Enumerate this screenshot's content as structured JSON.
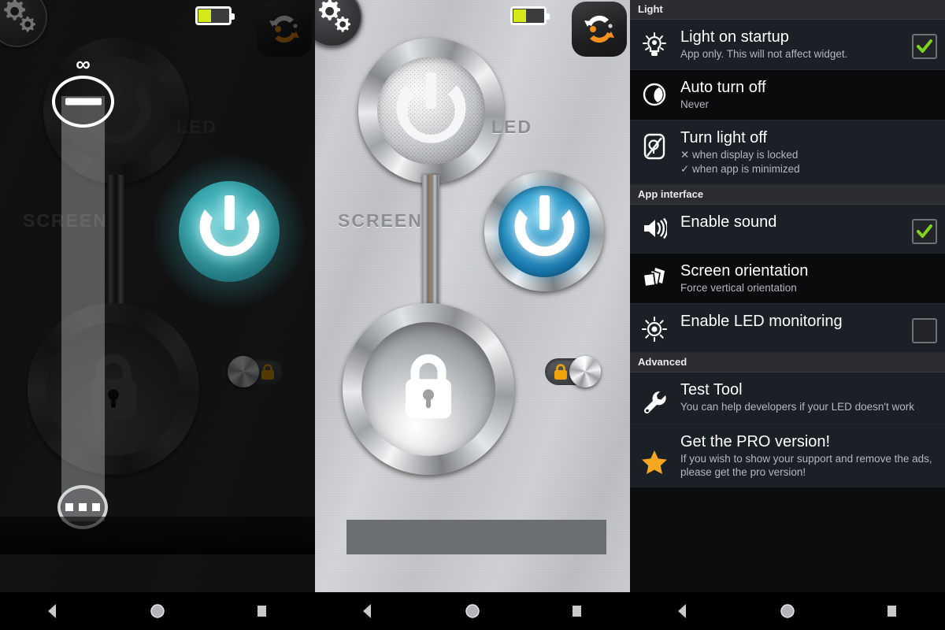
{
  "app": {
    "labels": {
      "screen": "SCREEN",
      "led": "LED",
      "infinity": "∞"
    },
    "battery": {
      "level_percent": 40
    },
    "icons": {
      "settings": "gears-icon",
      "battery": "battery-icon",
      "sync": "sync-rotate-icon",
      "screen_power": "power-icon",
      "led_power": "power-icon",
      "lock": "lock-icon",
      "slider_minus": "minus-icon",
      "slider_more": "more-dots-icon"
    },
    "lock_toggle": {
      "left_state": "off",
      "middle_state": "on"
    }
  },
  "navbar": {
    "back": "back-triangle-icon",
    "home": "home-circle-icon",
    "recents": "recents-square-icon"
  },
  "settings": {
    "sections": [
      {
        "header": "Light",
        "rows": [
          {
            "title": "Light on startup",
            "sub": "App only. This will not affect widget.",
            "icon": "lightbulb-icon",
            "control": "checkbox",
            "checked": true
          },
          {
            "title": "Auto turn off",
            "sub": "Never",
            "icon": "moon-icon",
            "control": "none",
            "checked": false
          },
          {
            "title": "Turn light off",
            "sub_x": "✕ when display is locked",
            "sub_ok": "✓ when app is minimized",
            "icon": "light-off-icon",
            "control": "none",
            "checked": false
          }
        ]
      },
      {
        "header": "App interface",
        "rows": [
          {
            "title": "Enable sound",
            "sub": "",
            "icon": "speaker-icon",
            "control": "checkbox",
            "checked": true
          },
          {
            "title": "Screen orientation",
            "sub": "Force vertical orientation",
            "icon": "orientation-cards-icon",
            "control": "none",
            "checked": false
          },
          {
            "title": "Enable LED monitoring",
            "sub": "",
            "icon": "brightness-eye-icon",
            "control": "checkbox",
            "checked": false
          }
        ]
      },
      {
        "header": "Advanced",
        "rows": [
          {
            "title": "Test Tool",
            "sub": "You can help developers if your LED doesn't work",
            "icon": "wrench-icon",
            "control": "none",
            "checked": false
          },
          {
            "title": "Get the PRO version!",
            "sub": "If you wish to show your support and remove the ads, please get the pro version!",
            "icon": "star-icon",
            "control": "none",
            "checked": false
          }
        ]
      }
    ]
  },
  "colors": {
    "led_blue": "#2f9ccd",
    "screen_teal": "#3aa8b0",
    "check_green": "#7ed321",
    "star_gold": "#f5a623",
    "battery_fill": "#d5e819",
    "lock_orange": "#f0a30a"
  }
}
